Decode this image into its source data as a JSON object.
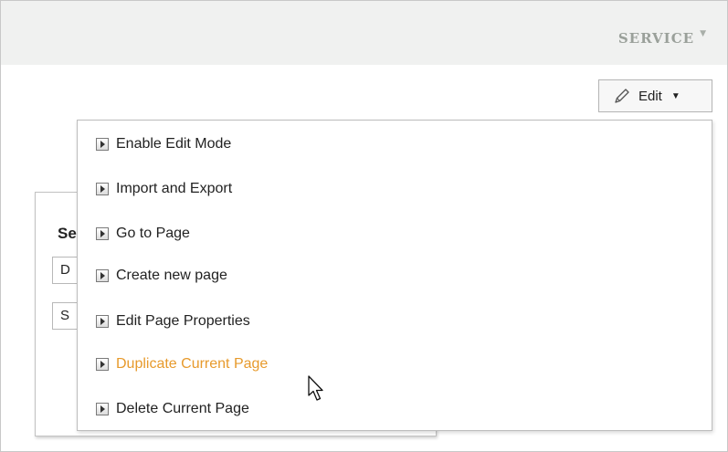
{
  "header": {
    "service_label": "SERVICE",
    "service_caret": "▼"
  },
  "toolbar": {
    "edit_label": "Edit",
    "edit_caret": "▼",
    "edit_icon": "pencil-icon"
  },
  "background_panel": {
    "title_fragment": "Se",
    "field_1": "D",
    "field_2": "S"
  },
  "edit_menu": {
    "items": [
      {
        "label": "Enable Edit Mode"
      },
      {
        "label": "Import and Export"
      },
      {
        "label": "Go to Page"
      },
      {
        "label": "Create new page"
      },
      {
        "label": "Edit Page Properties"
      },
      {
        "label": "Duplicate Current Page"
      },
      {
        "label": "Delete Current Page"
      }
    ],
    "highlight_color": "#e79a2c",
    "bullet_icon": "arrow-right-box-icon"
  },
  "colors": {
    "top_bar": "#f0f1f0",
    "service_text": "#9aa09a",
    "text": "#222222"
  }
}
